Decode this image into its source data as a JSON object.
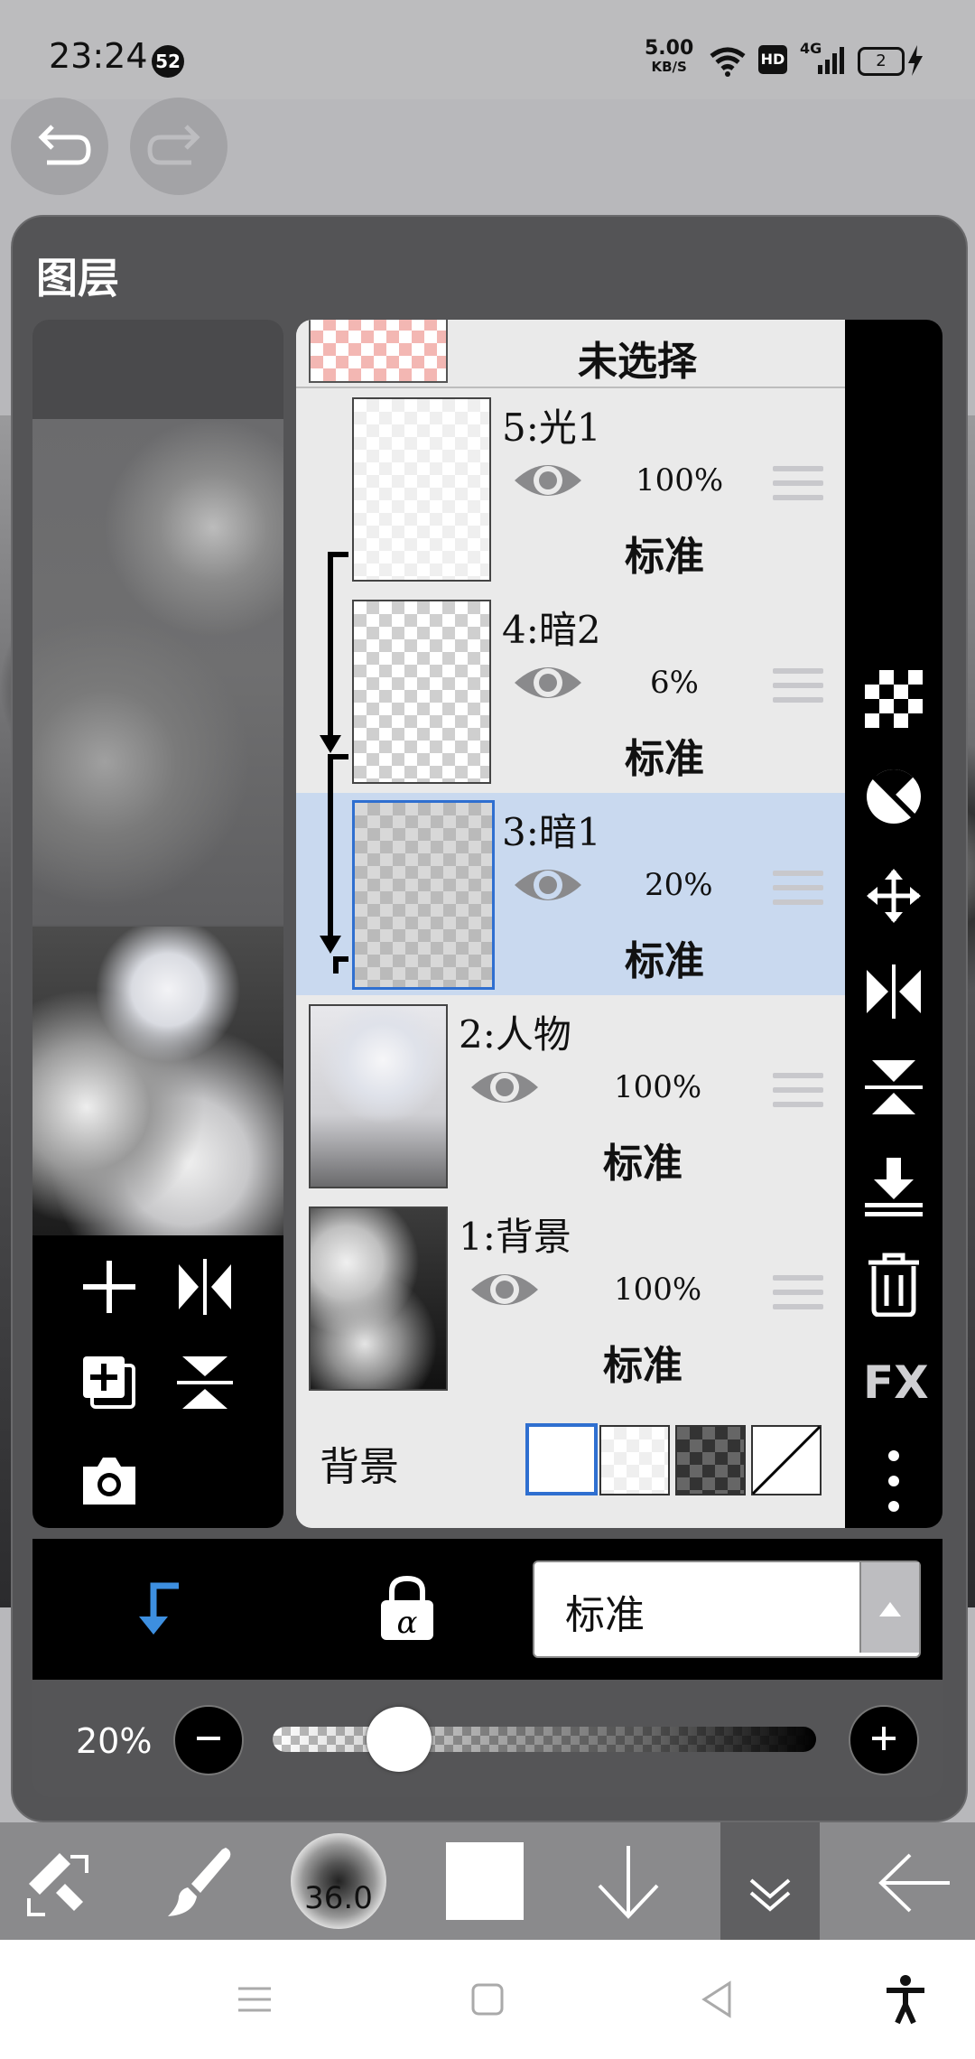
{
  "status_bar": {
    "time": "23:24",
    "notification_count": "52",
    "net_speed": "5.00",
    "net_speed_unit": "KB/S",
    "hd": "HD",
    "signal": "4G",
    "battery": "2"
  },
  "panel": {
    "title": "图层"
  },
  "layers": {
    "partial_top": {
      "name": "未选择"
    },
    "items": [
      {
        "name": "5:光1",
        "opacity": "100%",
        "blend": "标准"
      },
      {
        "name": "4:暗2",
        "opacity": "6%",
        "blend": "标准"
      },
      {
        "name": "3:暗1",
        "opacity": "20%",
        "blend": "标准"
      },
      {
        "name": "2:人物",
        "opacity": "100%",
        "blend": "标准"
      },
      {
        "name": "1:背景",
        "opacity": "100%",
        "blend": "标准"
      }
    ],
    "background_label": "背景"
  },
  "right_toolbar": {
    "fx": "FX"
  },
  "blend_mode": {
    "selected": "标准"
  },
  "opacity": {
    "label": "20%",
    "value": 0.2
  },
  "bottom_toolbar": {
    "brush_size": "36.0"
  },
  "colors": {
    "accent": "#2f6fd0",
    "selected_row": "#c9d9ef",
    "clip_arrow_blue": "#3d8fe0"
  }
}
